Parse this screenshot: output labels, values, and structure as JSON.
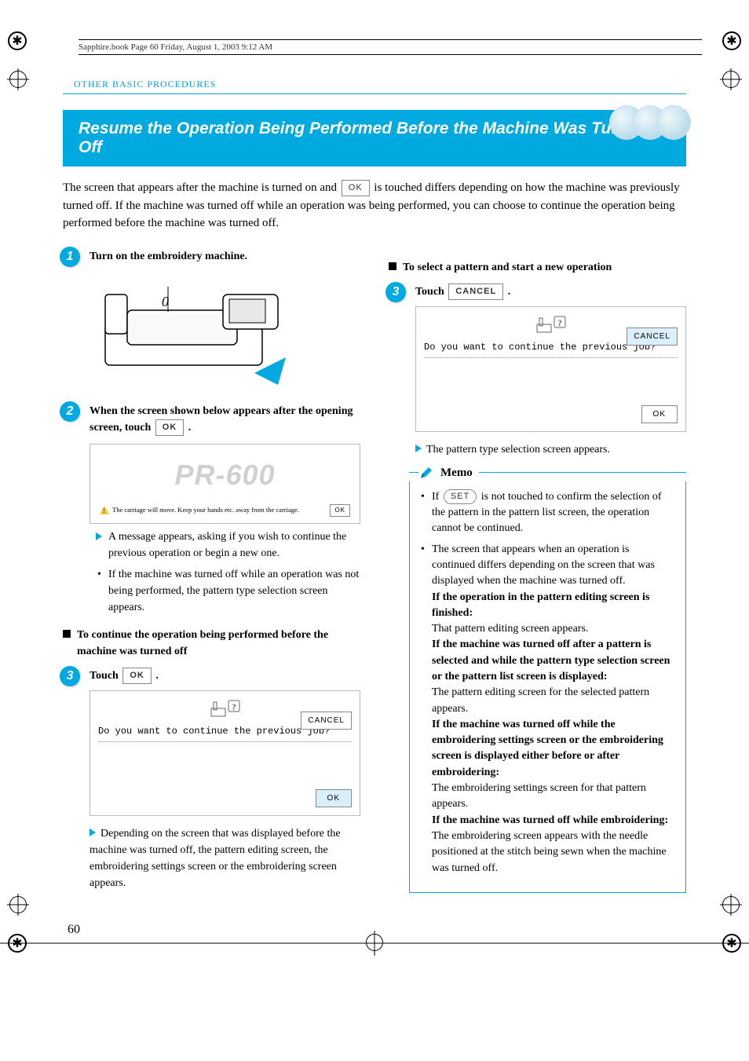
{
  "book_header": "Sapphire.book  Page 60  Friday, August 1, 2003  9:12 AM",
  "chapter": "OTHER BASIC PROCEDURES",
  "banner_title": "Resume the Operation Being Performed Before the Machine Was Turned Off",
  "intro_pre": "The screen that appears after the machine is turned on and ",
  "intro_ok": "OK",
  "intro_post": " is touched differs depending on how the machine was previously turned off. If the machine was turned off while an operation was being performed, you can choose to continue the operation being performed before the machine was turned off.",
  "steps": {
    "s1_title": "Turn on the embroidery machine.",
    "s2_title_a": "When the screen shown below appears after the opening screen, touch ",
    "s2_ok": "OK",
    "s2_title_b": ".",
    "pr600_logo": "PR-600",
    "pr600_msg": "The carriage will move. Keep your hands etc. away from the carriage.",
    "pr600_ok": "OK",
    "s2_note1": "A message appears, asking if you wish to continue the previous operation or begin a new one.",
    "s2_note2": "If the machine was turned off while an operation was not being performed, the pattern type selection screen appears.",
    "sub_continue": "To continue the operation being performed before the machine was turned off",
    "s3a_touch": "Touch ",
    "s3a_ok": "OK",
    "s3a_period": ".",
    "dialog_q": "Do you want to continue the previous job?",
    "dialog_cancel": "CANCEL",
    "dialog_ok": "OK",
    "s3a_result": "Depending on the screen that was displayed before the machine was turned off, the pattern editing screen, the embroidering settings screen or the embroidering screen appears.",
    "sub_new": "To select a pattern and start a new operation",
    "s3b_touch": "Touch ",
    "s3b_cancel": "CANCEL",
    "s3b_period": ".",
    "s3b_result": "The pattern type selection screen appears."
  },
  "memo": {
    "title": "Memo",
    "set_label": "SET",
    "b1_pre": "If ",
    "b1_post": " is not touched to confirm the selection of the pattern in the pattern list screen, the operation cannot be continued.",
    "b2": "The screen that appears when an operation is continued differs depending on the screen that was displayed when the machine was turned off.",
    "b2_h1": "If the operation in the pattern editing screen is finished:",
    "b2_t1": "That pattern editing screen appears.",
    "b2_h2": "If the machine was turned off after a pattern is selected and while the pattern type selection screen or the pattern list screen is displayed:",
    "b2_t2": "The pattern editing screen for the selected pattern appears.",
    "b2_h3": "If the machine was turned off while the embroidering settings screen or the embroidering screen is displayed either before or after embroidering:",
    "b2_t3": "The embroidering settings screen for that pattern appears.",
    "b2_h4": "If the machine was turned off while embroidering:",
    "b2_t4": "The embroidering screen appears with the needle positioned at the stitch being sewn when the machine was turned off."
  },
  "page_number": "60",
  "fig_labels": {
    "zero": "0"
  }
}
